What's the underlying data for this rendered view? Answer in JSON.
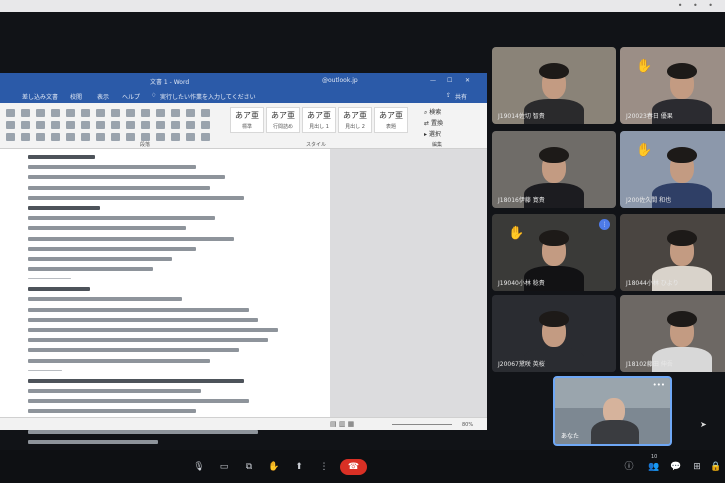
{
  "word": {
    "title": "文書 1 - Word",
    "account": "@outlook.jp",
    "menu": {
      "items": [
        "差し込み文書",
        "校閲",
        "表示",
        "ヘルプ"
      ],
      "tell_me": "実行したい作業を入力してください",
      "share": "共有"
    },
    "ribbon": {
      "styles": [
        {
          "preview": "あア亜",
          "name": "標準"
        },
        {
          "preview": "あア亜",
          "name": "行間詰め"
        },
        {
          "preview": "あア亜",
          "name": "見出し 1"
        },
        {
          "preview": "あア亜",
          "name": "見出し 2"
        },
        {
          "preview": "あア亜",
          "name": "表題"
        }
      ],
      "groups": {
        "paragraph": "段落",
        "style": "スタイル",
        "edit": "編集"
      },
      "edit_items": {
        "find": "検索",
        "replace": "置換",
        "select": "選択"
      }
    },
    "doc_lines": [
      {
        "text": "",
        "kind": "head"
      },
      {
        "text": "",
        "kind": "text"
      },
      {
        "text": "",
        "kind": "text"
      },
      {
        "text": "",
        "kind": "text"
      },
      {
        "text": "",
        "kind": "text"
      },
      {
        "text": "",
        "kind": "head"
      },
      {
        "text": "",
        "kind": "text"
      },
      {
        "text": "",
        "kind": "text"
      },
      {
        "text": "",
        "kind": "text"
      },
      {
        "text": "",
        "kind": "text"
      },
      {
        "text": "",
        "kind": "text"
      },
      {
        "text": "",
        "kind": "text"
      },
      {
        "text": "",
        "kind": "rule"
      },
      {
        "text": "",
        "kind": "head"
      },
      {
        "text": "",
        "kind": "text"
      },
      {
        "text": "",
        "kind": "text"
      },
      {
        "text": "",
        "kind": "text"
      },
      {
        "text": "",
        "kind": "text"
      },
      {
        "text": "",
        "kind": "text"
      },
      {
        "text": "",
        "kind": "text"
      },
      {
        "text": "",
        "kind": "text"
      },
      {
        "text": "",
        "kind": "rule"
      },
      {
        "text": "",
        "kind": "head"
      },
      {
        "text": "",
        "kind": "text"
      },
      {
        "text": "",
        "kind": "text"
      },
      {
        "text": "",
        "kind": "text"
      },
      {
        "text": "",
        "kind": "text"
      },
      {
        "text": "",
        "kind": "text"
      },
      {
        "text": "",
        "kind": "text"
      }
    ],
    "status": {
      "zoom": "80%"
    }
  },
  "participants": [
    {
      "name": "J19014佐切 智貴",
      "raised_hand": false,
      "mic_badge": false,
      "bg": "#8a8378",
      "shirt": "#2a2a2c"
    },
    {
      "name": "J20023春日 優果",
      "raised_hand": true,
      "mic_badge": false,
      "bg": "#9b8e86",
      "shirt": "#2b2b30"
    },
    {
      "name": "J18016伊藤 寛貴",
      "raised_hand": false,
      "mic_badge": false,
      "bg": "#6f6c68",
      "shirt": "#1c1c20"
    },
    {
      "name": "J200佐久間 和也",
      "raised_hand": true,
      "mic_badge": false,
      "bg": "#8c98ab",
      "shirt": "#2f3f66"
    },
    {
      "name": "J19040小林 稔貴",
      "raised_hand": true,
      "mic_badge": true,
      "bg": "#3a3a38",
      "shirt": "#121214"
    },
    {
      "name": "J18044小林 ひより",
      "raised_hand": false,
      "mic_badge": false,
      "bg": "#4a4541",
      "shirt": "#d9d3cb"
    },
    {
      "name": "J20067黛咲 英桜",
      "raised_hand": false,
      "mic_badge": false,
      "bg": "#2a2c31",
      "shirt": "#2a2c31"
    },
    {
      "name": "J18102藤田 伸吾",
      "raised_hand": false,
      "mic_badge": false,
      "bg": "#6d6864",
      "shirt": "#d8d8d8"
    }
  ],
  "self_view": {
    "name": "あなた",
    "more_icon": "more-horiz-icon"
  },
  "toolbar": {
    "center": [
      "mic-icon",
      "camera-icon",
      "captions-icon",
      "raise-hand-icon",
      "present-icon",
      "more-vert-icon",
      "end-call-icon"
    ],
    "right": [
      "info-icon",
      "people-icon",
      "chat-icon",
      "activities-icon",
      "lock-icon"
    ],
    "people_count": "10"
  },
  "colors": {
    "accent": "#6fa8f6",
    "end_call": "#d93025",
    "word_blue": "#2b5aa8"
  }
}
